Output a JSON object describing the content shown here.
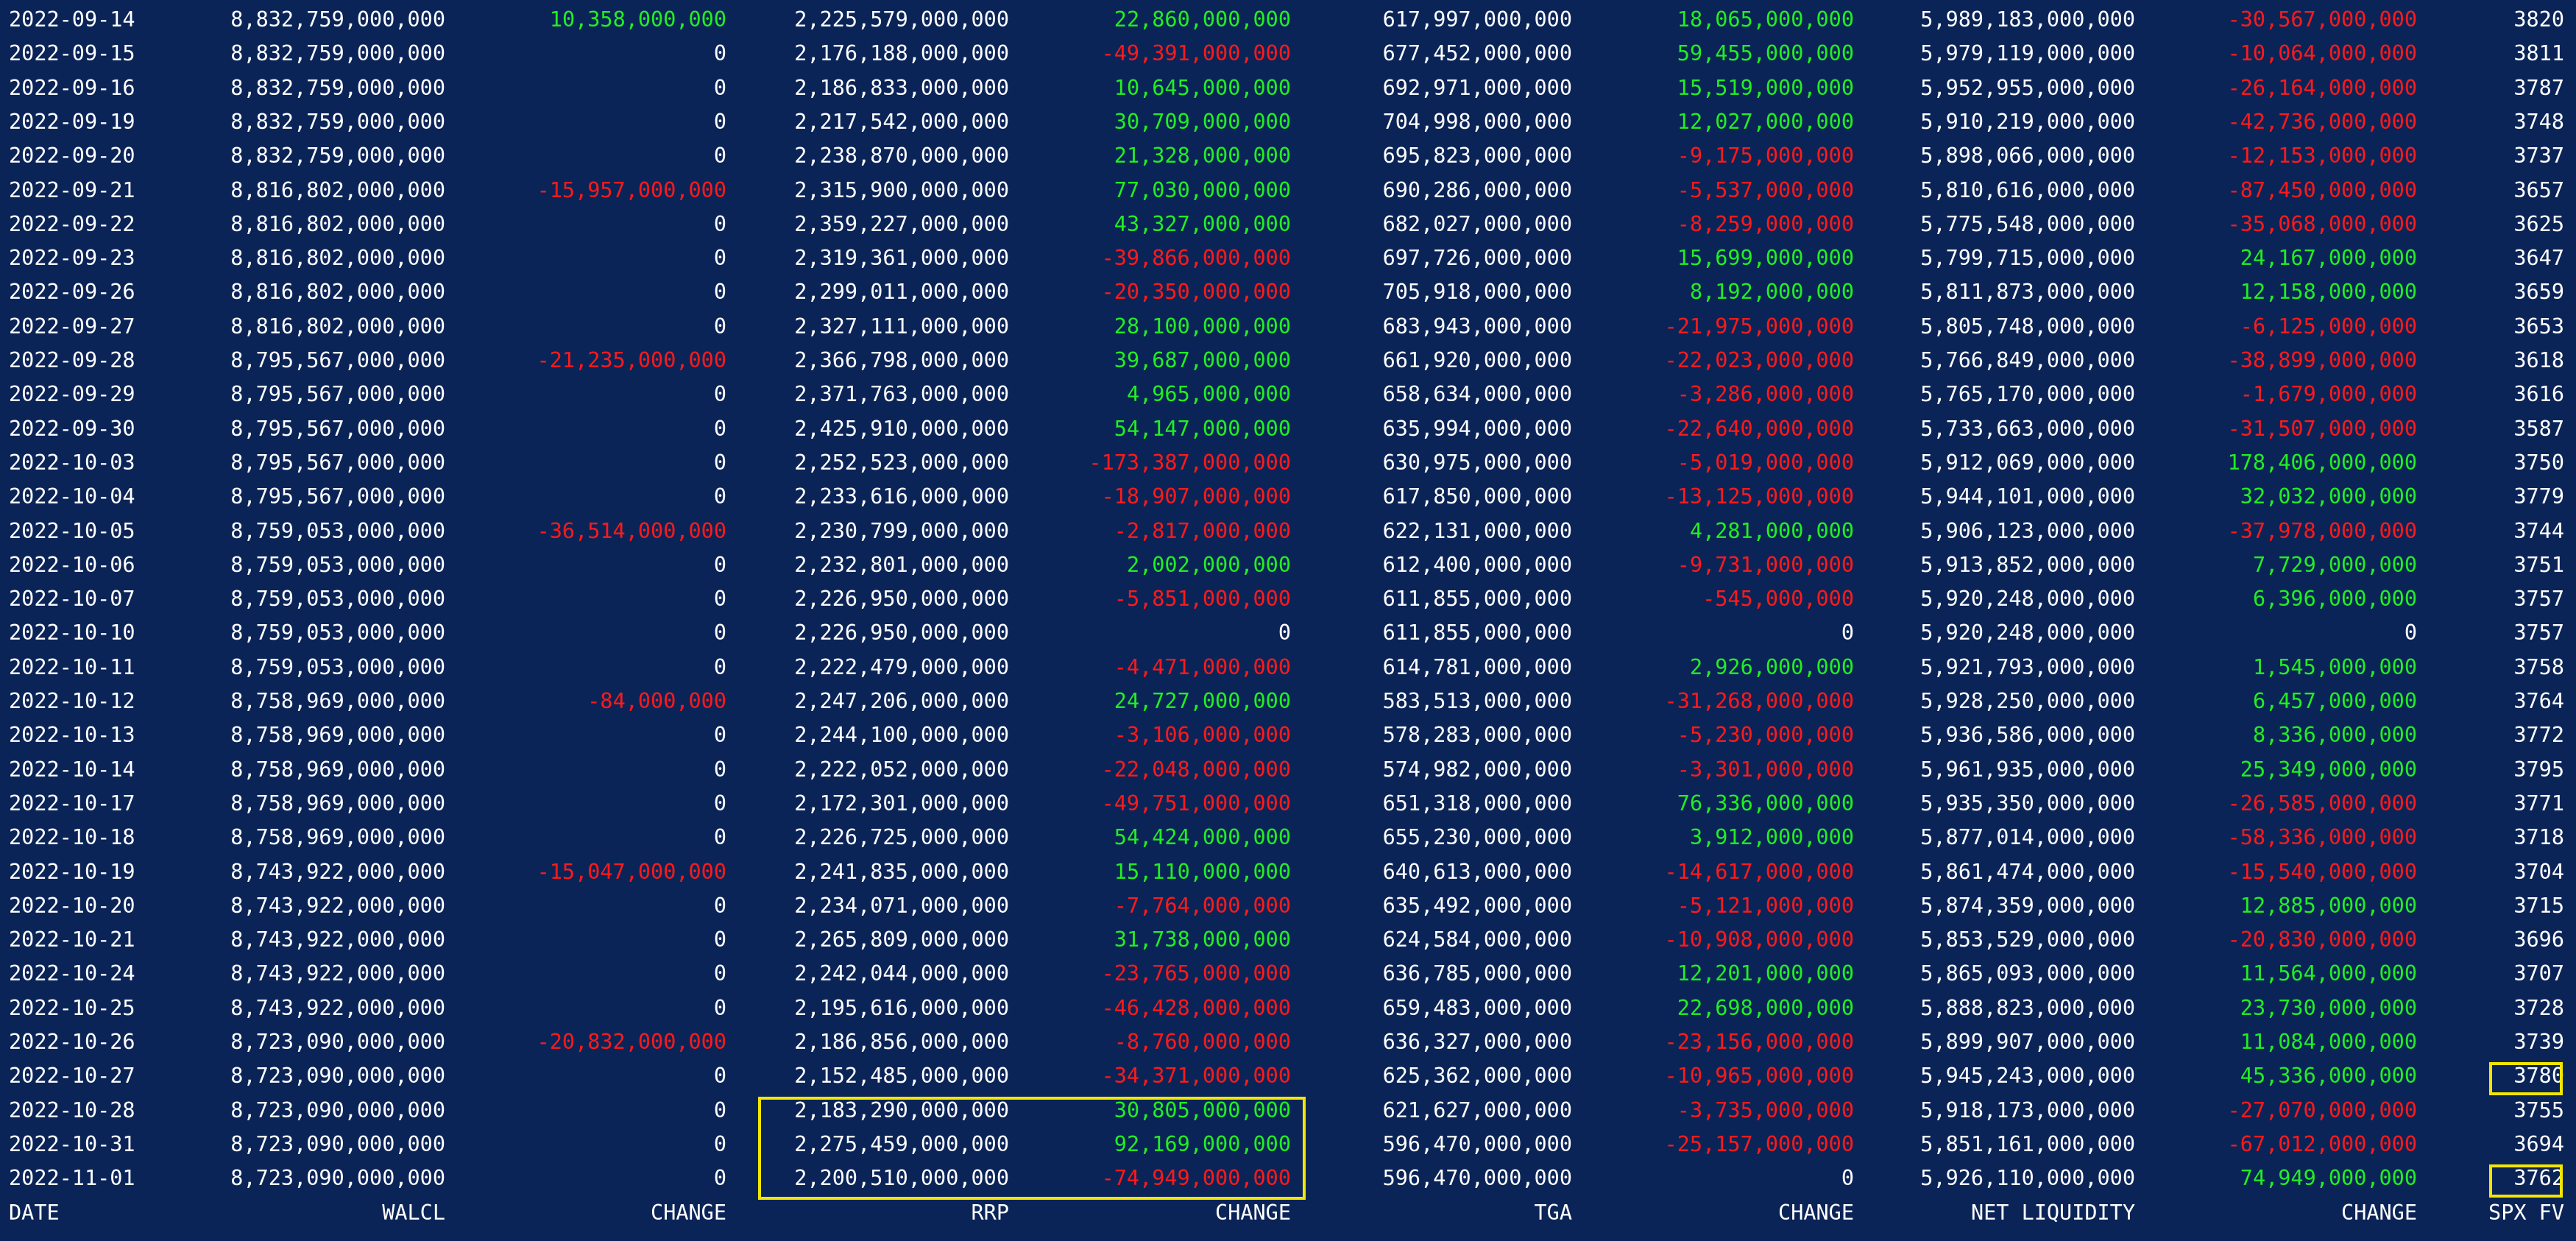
{
  "columns": [
    "DATE",
    "WALCL",
    "CHANGE",
    "RRP",
    "CHANGE",
    "TGA",
    "CHANGE",
    "NET LIQUIDITY",
    "CHANGE",
    "SPX FV"
  ],
  "rows": [
    [
      "2022-09-14",
      "8,832,759,000,000",
      "10,358,000,000",
      "2,225,579,000,000",
      "22,860,000,000",
      "617,997,000,000",
      "18,065,000,000",
      "5,989,183,000,000",
      "-30,567,000,000",
      "3820"
    ],
    [
      "2022-09-15",
      "8,832,759,000,000",
      "0",
      "2,176,188,000,000",
      "-49,391,000,000",
      "677,452,000,000",
      "59,455,000,000",
      "5,979,119,000,000",
      "-10,064,000,000",
      "3811"
    ],
    [
      "2022-09-16",
      "8,832,759,000,000",
      "0",
      "2,186,833,000,000",
      "10,645,000,000",
      "692,971,000,000",
      "15,519,000,000",
      "5,952,955,000,000",
      "-26,164,000,000",
      "3787"
    ],
    [
      "2022-09-19",
      "8,832,759,000,000",
      "0",
      "2,217,542,000,000",
      "30,709,000,000",
      "704,998,000,000",
      "12,027,000,000",
      "5,910,219,000,000",
      "-42,736,000,000",
      "3748"
    ],
    [
      "2022-09-20",
      "8,832,759,000,000",
      "0",
      "2,238,870,000,000",
      "21,328,000,000",
      "695,823,000,000",
      "-9,175,000,000",
      "5,898,066,000,000",
      "-12,153,000,000",
      "3737"
    ],
    [
      "2022-09-21",
      "8,816,802,000,000",
      "-15,957,000,000",
      "2,315,900,000,000",
      "77,030,000,000",
      "690,286,000,000",
      "-5,537,000,000",
      "5,810,616,000,000",
      "-87,450,000,000",
      "3657"
    ],
    [
      "2022-09-22",
      "8,816,802,000,000",
      "0",
      "2,359,227,000,000",
      "43,327,000,000",
      "682,027,000,000",
      "-8,259,000,000",
      "5,775,548,000,000",
      "-35,068,000,000",
      "3625"
    ],
    [
      "2022-09-23",
      "8,816,802,000,000",
      "0",
      "2,319,361,000,000",
      "-39,866,000,000",
      "697,726,000,000",
      "15,699,000,000",
      "5,799,715,000,000",
      "24,167,000,000",
      "3647"
    ],
    [
      "2022-09-26",
      "8,816,802,000,000",
      "0",
      "2,299,011,000,000",
      "-20,350,000,000",
      "705,918,000,000",
      "8,192,000,000",
      "5,811,873,000,000",
      "12,158,000,000",
      "3659"
    ],
    [
      "2022-09-27",
      "8,816,802,000,000",
      "0",
      "2,327,111,000,000",
      "28,100,000,000",
      "683,943,000,000",
      "-21,975,000,000",
      "5,805,748,000,000",
      "-6,125,000,000",
      "3653"
    ],
    [
      "2022-09-28",
      "8,795,567,000,000",
      "-21,235,000,000",
      "2,366,798,000,000",
      "39,687,000,000",
      "661,920,000,000",
      "-22,023,000,000",
      "5,766,849,000,000",
      "-38,899,000,000",
      "3618"
    ],
    [
      "2022-09-29",
      "8,795,567,000,000",
      "0",
      "2,371,763,000,000",
      "4,965,000,000",
      "658,634,000,000",
      "-3,286,000,000",
      "5,765,170,000,000",
      "-1,679,000,000",
      "3616"
    ],
    [
      "2022-09-30",
      "8,795,567,000,000",
      "0",
      "2,425,910,000,000",
      "54,147,000,000",
      "635,994,000,000",
      "-22,640,000,000",
      "5,733,663,000,000",
      "-31,507,000,000",
      "3587"
    ],
    [
      "2022-10-03",
      "8,795,567,000,000",
      "0",
      "2,252,523,000,000",
      "-173,387,000,000",
      "630,975,000,000",
      "-5,019,000,000",
      "5,912,069,000,000",
      "178,406,000,000",
      "3750"
    ],
    [
      "2022-10-04",
      "8,795,567,000,000",
      "0",
      "2,233,616,000,000",
      "-18,907,000,000",
      "617,850,000,000",
      "-13,125,000,000",
      "5,944,101,000,000",
      "32,032,000,000",
      "3779"
    ],
    [
      "2022-10-05",
      "8,759,053,000,000",
      "-36,514,000,000",
      "2,230,799,000,000",
      "-2,817,000,000",
      "622,131,000,000",
      "4,281,000,000",
      "5,906,123,000,000",
      "-37,978,000,000",
      "3744"
    ],
    [
      "2022-10-06",
      "8,759,053,000,000",
      "0",
      "2,232,801,000,000",
      "2,002,000,000",
      "612,400,000,000",
      "-9,731,000,000",
      "5,913,852,000,000",
      "7,729,000,000",
      "3751"
    ],
    [
      "2022-10-07",
      "8,759,053,000,000",
      "0",
      "2,226,950,000,000",
      "-5,851,000,000",
      "611,855,000,000",
      "-545,000,000",
      "5,920,248,000,000",
      "6,396,000,000",
      "3757"
    ],
    [
      "2022-10-10",
      "8,759,053,000,000",
      "0",
      "2,226,950,000,000",
      "0",
      "611,855,000,000",
      "0",
      "5,920,248,000,000",
      "0",
      "3757"
    ],
    [
      "2022-10-11",
      "8,759,053,000,000",
      "0",
      "2,222,479,000,000",
      "-4,471,000,000",
      "614,781,000,000",
      "2,926,000,000",
      "5,921,793,000,000",
      "1,545,000,000",
      "3758"
    ],
    [
      "2022-10-12",
      "8,758,969,000,000",
      "-84,000,000",
      "2,247,206,000,000",
      "24,727,000,000",
      "583,513,000,000",
      "-31,268,000,000",
      "5,928,250,000,000",
      "6,457,000,000",
      "3764"
    ],
    [
      "2022-10-13",
      "8,758,969,000,000",
      "0",
      "2,244,100,000,000",
      "-3,106,000,000",
      "578,283,000,000",
      "-5,230,000,000",
      "5,936,586,000,000",
      "8,336,000,000",
      "3772"
    ],
    [
      "2022-10-14",
      "8,758,969,000,000",
      "0",
      "2,222,052,000,000",
      "-22,048,000,000",
      "574,982,000,000",
      "-3,301,000,000",
      "5,961,935,000,000",
      "25,349,000,000",
      "3795"
    ],
    [
      "2022-10-17",
      "8,758,969,000,000",
      "0",
      "2,172,301,000,000",
      "-49,751,000,000",
      "651,318,000,000",
      "76,336,000,000",
      "5,935,350,000,000",
      "-26,585,000,000",
      "3771"
    ],
    [
      "2022-10-18",
      "8,758,969,000,000",
      "0",
      "2,226,725,000,000",
      "54,424,000,000",
      "655,230,000,000",
      "3,912,000,000",
      "5,877,014,000,000",
      "-58,336,000,000",
      "3718"
    ],
    [
      "2022-10-19",
      "8,743,922,000,000",
      "-15,047,000,000",
      "2,241,835,000,000",
      "15,110,000,000",
      "640,613,000,000",
      "-14,617,000,000",
      "5,861,474,000,000",
      "-15,540,000,000",
      "3704"
    ],
    [
      "2022-10-20",
      "8,743,922,000,000",
      "0",
      "2,234,071,000,000",
      "-7,764,000,000",
      "635,492,000,000",
      "-5,121,000,000",
      "5,874,359,000,000",
      "12,885,000,000",
      "3715"
    ],
    [
      "2022-10-21",
      "8,743,922,000,000",
      "0",
      "2,265,809,000,000",
      "31,738,000,000",
      "624,584,000,000",
      "-10,908,000,000",
      "5,853,529,000,000",
      "-20,830,000,000",
      "3696"
    ],
    [
      "2022-10-24",
      "8,743,922,000,000",
      "0",
      "2,242,044,000,000",
      "-23,765,000,000",
      "636,785,000,000",
      "12,201,000,000",
      "5,865,093,000,000",
      "11,564,000,000",
      "3707"
    ],
    [
      "2022-10-25",
      "8,743,922,000,000",
      "0",
      "2,195,616,000,000",
      "-46,428,000,000",
      "659,483,000,000",
      "22,698,000,000",
      "5,888,823,000,000",
      "23,730,000,000",
      "3728"
    ],
    [
      "2022-10-26",
      "8,723,090,000,000",
      "-20,832,000,000",
      "2,186,856,000,000",
      "-8,760,000,000",
      "636,327,000,000",
      "-23,156,000,000",
      "5,899,907,000,000",
      "11,084,000,000",
      "3739"
    ],
    [
      "2022-10-27",
      "8,723,090,000,000",
      "0",
      "2,152,485,000,000",
      "-34,371,000,000",
      "625,362,000,000",
      "-10,965,000,000",
      "5,945,243,000,000",
      "45,336,000,000",
      "3780"
    ],
    [
      "2022-10-28",
      "8,723,090,000,000",
      "0",
      "2,183,290,000,000",
      "30,805,000,000",
      "621,627,000,000",
      "-3,735,000,000",
      "5,918,173,000,000",
      "-27,070,000,000",
      "3755"
    ],
    [
      "2022-10-31",
      "8,723,090,000,000",
      "0",
      "2,275,459,000,000",
      "92,169,000,000",
      "596,470,000,000",
      "-25,157,000,000",
      "5,851,161,000,000",
      "-67,012,000,000",
      "3694"
    ],
    [
      "2022-11-01",
      "8,723,090,000,000",
      "0",
      "2,200,510,000,000",
      "-74,949,000,000",
      "596,470,000,000",
      "0",
      "5,926,110,000,000",
      "74,949,000,000",
      "3762"
    ]
  ],
  "colors": {
    "background": "#0b2458",
    "text": "#ffffff",
    "positive_change": "#22ee22",
    "negative_change": "#ff1a1a",
    "highlight_box": "#f2e600"
  }
}
